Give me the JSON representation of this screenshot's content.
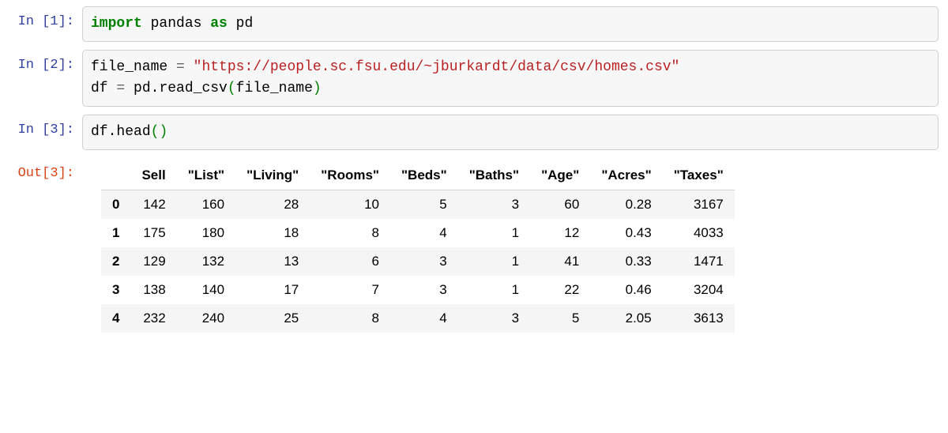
{
  "cells": [
    {
      "prompt_in": "In [1]:",
      "code": {
        "kw_import": "import",
        "mod": " pandas ",
        "kw_as": "as",
        "alias": " pd"
      }
    },
    {
      "prompt_in": "In [2]:",
      "code": {
        "var1": "file_name ",
        "op1": "=",
        "sp1": " ",
        "str1": "\"https://people.sc.fsu.edu/~jburkardt/data/csv/homes.csv\"",
        "nl": "\n",
        "var2": "df ",
        "op2": "=",
        "expr": " pd",
        "dot": ".",
        "fn": "read_csv",
        "po": "(",
        "arg": "file_name",
        "pc": ")"
      }
    },
    {
      "prompt_in": "In [3]:",
      "prompt_out": "Out[3]:",
      "code": {
        "expr": "df",
        "dot": ".",
        "fn": "head",
        "po": "(",
        "pc": ")"
      },
      "table": {
        "headers": [
          "",
          "Sell",
          "\"List\"",
          "\"Living\"",
          "\"Rooms\"",
          "\"Beds\"",
          "\"Baths\"",
          "\"Age\"",
          "\"Acres\"",
          "\"Taxes\""
        ],
        "rows": [
          {
            "idx": "0",
            "cells": [
              "142",
              "160",
              "28",
              "10",
              "5",
              "3",
              "60",
              "0.28",
              "3167"
            ]
          },
          {
            "idx": "1",
            "cells": [
              "175",
              "180",
              "18",
              "8",
              "4",
              "1",
              "12",
              "0.43",
              "4033"
            ]
          },
          {
            "idx": "2",
            "cells": [
              "129",
              "132",
              "13",
              "6",
              "3",
              "1",
              "41",
              "0.33",
              "1471"
            ]
          },
          {
            "idx": "3",
            "cells": [
              "138",
              "140",
              "17",
              "7",
              "3",
              "1",
              "22",
              "0.46",
              "3204"
            ]
          },
          {
            "idx": "4",
            "cells": [
              "232",
              "240",
              "25",
              "8",
              "4",
              "3",
              "5",
              "2.05",
              "3613"
            ]
          }
        ]
      }
    }
  ]
}
